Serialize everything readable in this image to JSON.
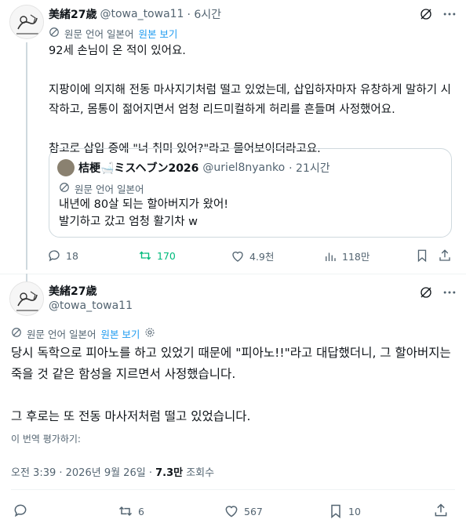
{
  "tweet1": {
    "display_name": "美緒27歳",
    "handle": "@towa_towa11",
    "time": "· 6시간",
    "translated_from": "원문 언어 일본어",
    "show_original": "원본 보기",
    "text": "92세 손님이 온 적이 있어요.\n\n지팡이에 의지해 전동 마사지기처럼 떨고 있었는데, 삽입하자마자 유창하게 말하기 시작하고, 몸통이 젊어지면서 엄청 리드미컬하게 허리를 흔들며 사정했어요.\n\n참고로 삽입 중에 \"너 취미 있어?\"라고 물어보이더라고요.",
    "quote": {
      "display_name": "桔梗🛁ミスヘブン2026",
      "handle": "@uriel8nyanko",
      "time": "· 21시간",
      "translated_from": "원문 언어 일본어",
      "text": "내년에 80살 되는 할아버지가 왔어!\n발기하고 갔고 엄청 활기차 w"
    },
    "actions": {
      "replies": "18",
      "retweets": "170",
      "likes": "4.9천",
      "views": "118만"
    }
  },
  "tweet2": {
    "display_name": "美緒27歳",
    "handle": "@towa_towa11",
    "translated_from": "원문 언어 일본어",
    "show_original": "원본 보기",
    "text": "당시 독학으로 피아노를 하고 있었기 때문에 \"피아노!!\"라고 대답했더니, 그 할아버지는 죽을 것 같은 함성을 지르면서 사정했습니다.\n\n그 후로는 또 전동 마사저처럼 떨고 있었습니다.",
    "rate_translation": "이 번역 평가하기:",
    "timestamp": "오전 3:39 · 2026년 9월 26일 · ",
    "views_count": "7.3만",
    "views_label": " 조회수",
    "actions": {
      "retweets": "6",
      "likes": "567",
      "bookmarks": "10"
    }
  },
  "colors": {
    "retweet_active": "#00ba7c",
    "link": "#1d9bf0",
    "grey": "#536471"
  }
}
